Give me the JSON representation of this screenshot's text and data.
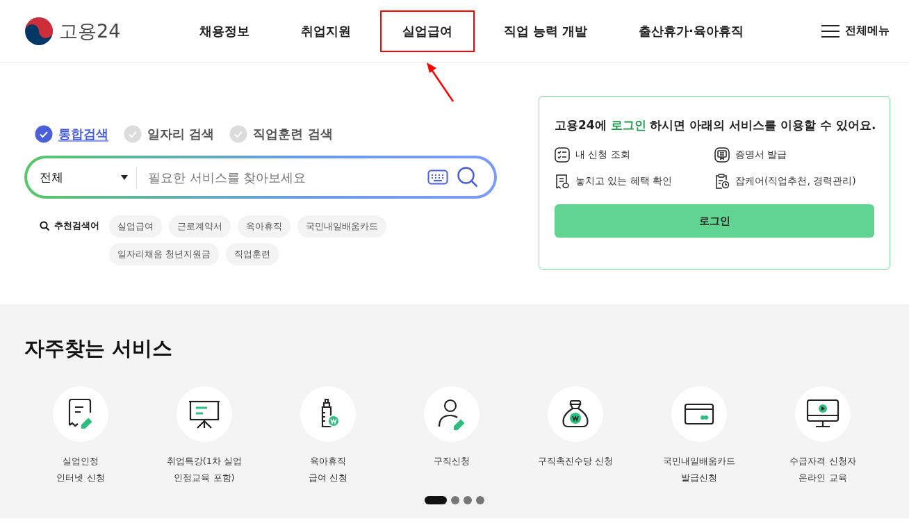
{
  "logo": {
    "text": "고용24"
  },
  "nav": [
    {
      "label": "채용정보",
      "highlighted": false
    },
    {
      "label": "취업지원",
      "highlighted": false
    },
    {
      "label": "실업급여",
      "highlighted": true
    },
    {
      "label": "직업 능력 개발",
      "highlighted": false
    },
    {
      "label": "출산휴가·육아휴직",
      "highlighted": false
    }
  ],
  "all_menu": "전체메뉴",
  "search_tabs": [
    {
      "label": "통합검색",
      "selected": true
    },
    {
      "label": "일자리 검색",
      "selected": false
    },
    {
      "label": "직업훈련 검색",
      "selected": false
    }
  ],
  "search": {
    "category": "전체",
    "placeholder": "필요한 서비스를 찾아보세요"
  },
  "recommended": {
    "label": "추천검색어",
    "tags": [
      "실업급여",
      "근로계약서",
      "육아휴직",
      "국민내일배움카드",
      "일자리채움 청년지원금",
      "직업훈련"
    ]
  },
  "login_card": {
    "message": "고용24에 **로그인** 하시면 아래의 서비스를 이용할 수 있어요.",
    "features": [
      {
        "kind": "checklist",
        "label": "내 신청 조회"
      },
      {
        "kind": "certificate",
        "label": "증명서 발급"
      },
      {
        "kind": "receipt",
        "label": "놓치고 있는 혜택 확인"
      },
      {
        "kind": "clipboard",
        "label": "잡케어(직업추천, 경력관리)"
      }
    ],
    "button": "로그인"
  },
  "services": {
    "title": "자주찾는 서비스",
    "items": [
      {
        "kind": "receipt",
        "label": "실업인정\n인터넷 신청"
      },
      {
        "kind": "easel",
        "label": "취업특강(1차 실업\n인정교육 포함)"
      },
      {
        "kind": "bottle",
        "label": "육아휴직\n급여 신청"
      },
      {
        "kind": "person",
        "label": "구직신청"
      },
      {
        "kind": "moneybag",
        "label": "구직촉진수당 신청"
      },
      {
        "kind": "card",
        "label": "국민내일배움카드\n발급신청"
      },
      {
        "kind": "monitor",
        "label": "수급자격 신청자\n온라인 교육"
      }
    ],
    "pages": [
      {
        "selected": true
      },
      {
        "selected": false
      },
      {
        "selected": false
      },
      {
        "selected": false
      }
    ]
  }
}
